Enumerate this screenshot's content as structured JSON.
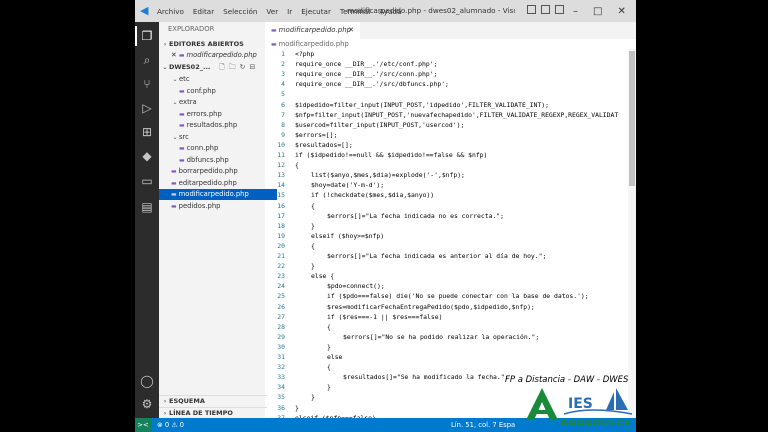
{
  "titlebar": {
    "menus": [
      "Archivo",
      "Editar",
      "Selección",
      "Ver",
      "Ir",
      "Ejecutar",
      "Terminal",
      "Ayuda"
    ],
    "title": "modificarpedido.php - dwes02_alumnado - Visual St..."
  },
  "sidebar": {
    "title": "EXPLORADOR",
    "open_editors_header": "EDITORES ABIERTOS",
    "open_editor_file": "modificarpedido.php",
    "workspace_header": "DWES02_...",
    "tree": [
      {
        "label": "etc",
        "type": "folder",
        "depth": 1
      },
      {
        "label": "conf.php",
        "type": "file",
        "depth": 2
      },
      {
        "label": "extra",
        "type": "folder",
        "depth": 1
      },
      {
        "label": "errors.php",
        "type": "file",
        "depth": 2
      },
      {
        "label": "resultados.php",
        "type": "file",
        "depth": 2
      },
      {
        "label": "src",
        "type": "folder",
        "depth": 1
      },
      {
        "label": "conn.php",
        "type": "file",
        "depth": 2
      },
      {
        "label": "dbfuncs.php",
        "type": "file",
        "depth": 2
      },
      {
        "label": "borrarpedido.php",
        "type": "file",
        "depth": 1
      },
      {
        "label": "editarpedido.php",
        "type": "file",
        "depth": 1
      },
      {
        "label": "modificarpedido.php",
        "type": "file",
        "depth": 1,
        "selected": true
      },
      {
        "label": "pedidos.php",
        "type": "file",
        "depth": 1
      }
    ],
    "outline_header": "ESQUEMA",
    "timeline_header": "LÍNEA DE TIEMPO"
  },
  "editor": {
    "tab_label": "modificarpedido.php",
    "breadcrumb": "modificarpedido.php",
    "lines": [
      {
        "n": "1",
        "indent": 0,
        "text": "<?php"
      },
      {
        "n": "2",
        "indent": 0,
        "text": "require_once __DIR__.'/etc/conf.php';"
      },
      {
        "n": "3",
        "indent": 0,
        "text": "require_once __DIR__.'/src/conn.php';"
      },
      {
        "n": "4",
        "indent": 0,
        "text": "require_once __DIR__.'/src/dbfuncs.php';"
      },
      {
        "n": "5",
        "indent": 0,
        "text": ""
      },
      {
        "n": "6",
        "indent": 0,
        "text": "$idpedido=filter_input(INPUT_POST,'idpedido',FILTER_VALIDATE_INT);"
      },
      {
        "n": "7",
        "indent": 0,
        "text": "$nfp=filter_input(INPUT_POST,'nuevafechapedido',FILTER_VALIDATE_REGEXP,REGEX_VALIDAT"
      },
      {
        "n": "8",
        "indent": 0,
        "text": "$usercod=filter_input(INPUT_POST,'usercod');"
      },
      {
        "n": "9",
        "indent": 0,
        "text": "$errors=[];"
      },
      {
        "n": "10",
        "indent": 0,
        "text": "$resultados=[];"
      },
      {
        "n": "11",
        "indent": 0,
        "text": "if ($idpedido!==null && $idpedido!==false && $nfp)"
      },
      {
        "n": "12",
        "indent": 0,
        "text": "{"
      },
      {
        "n": "13",
        "indent": 1,
        "text": "list($anyo,$mes,$dia)=explode('-',$nfp);"
      },
      {
        "n": "14",
        "indent": 1,
        "text": "$hoy=date('Y-m-d');"
      },
      {
        "n": "15",
        "indent": 1,
        "text": "if (!checkdate($mes,$dia,$anyo))"
      },
      {
        "n": "16",
        "indent": 1,
        "text": "{"
      },
      {
        "n": "17",
        "indent": 2,
        "text": "$errors[]=\"La fecha indicada no es correcta.\";"
      },
      {
        "n": "18",
        "indent": 1,
        "text": "}"
      },
      {
        "n": "19",
        "indent": 1,
        "text": "elseif ($hoy>=$nfp)"
      },
      {
        "n": "20",
        "indent": 1,
        "text": "{"
      },
      {
        "n": "21",
        "indent": 2,
        "text": "$errors[]=\"La fecha indicada es anterior al día de hoy.\";"
      },
      {
        "n": "22",
        "indent": 1,
        "text": "}"
      },
      {
        "n": "23",
        "indent": 1,
        "text": "else {"
      },
      {
        "n": "24",
        "indent": 2,
        "text": "$pdo=connect();"
      },
      {
        "n": "25",
        "indent": 2,
        "text": "if ($pdo===false) die('No se puede conectar con la base de datos.');"
      },
      {
        "n": "26",
        "indent": 2,
        "text": "$res=modificarFechaEntregaPedido($pdo,$idpedido,$nfp);"
      },
      {
        "n": "27",
        "indent": 2,
        "text": "if ($res===-1 || $res===false)"
      },
      {
        "n": "28",
        "indent": 2,
        "text": "{"
      },
      {
        "n": "29",
        "indent": 3,
        "text": "$errors[]=\"No se ha podido realizar la operación.\";"
      },
      {
        "n": "30",
        "indent": 2,
        "text": "}"
      },
      {
        "n": "31",
        "indent": 2,
        "text": "else"
      },
      {
        "n": "32",
        "indent": 2,
        "text": "{"
      },
      {
        "n": "33",
        "indent": 3,
        "text": "$resultados[]=\"Se ha modificado la fecha.\";"
      },
      {
        "n": "34",
        "indent": 2,
        "text": "}"
      },
      {
        "n": "35",
        "indent": 1,
        "text": "}"
      },
      {
        "n": "36",
        "indent": 0,
        "text": "}"
      },
      {
        "n": "37",
        "indent": 0,
        "text": "elseif ($nfp===false)"
      }
    ]
  },
  "statusbar": {
    "remote": "><",
    "problems": "⊗ 0 ⚠ 0",
    "position": "Lín. 51, col. 7    Espa"
  },
  "overlay": {
    "course_text": "FP a Distancia - DAW -  DWES",
    "logo_text": "AGUADULCE",
    "logo_letters": "IES"
  },
  "colors": {
    "accent": "#007acc",
    "activity_bar": "#2c2c2c",
    "selection": "#0060c0",
    "line_number": "#237893",
    "logo_green": "#1a8a3a",
    "logo_blue": "#2a6db5"
  }
}
